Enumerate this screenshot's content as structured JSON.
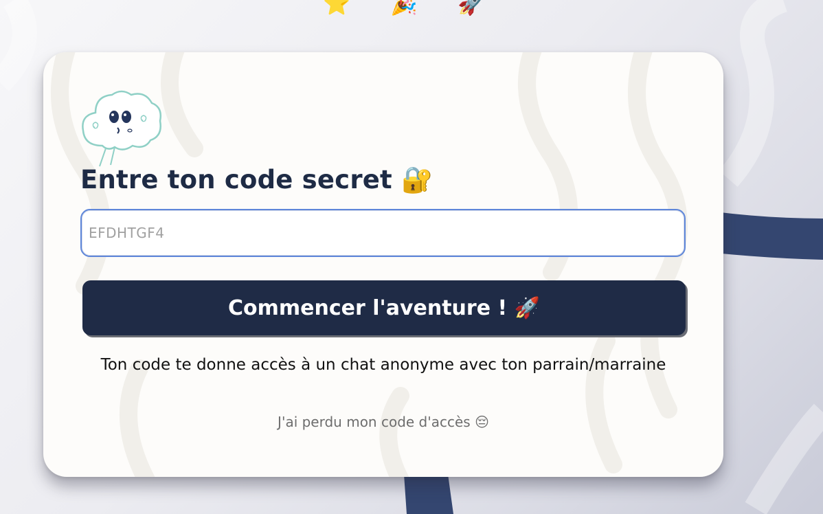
{
  "colors": {
    "accent": "#1f2b46",
    "title_text": "#1e2b45",
    "input_border": "#5e86d9",
    "muted_text": "#6d6d6d",
    "card_background": "#fdfcfa"
  },
  "decorations": {
    "top_emojis": "⭐ 🎉 🚀",
    "mascot_icon": "cloud-mascot-icon"
  },
  "login": {
    "title": "Entre ton code secret 🔐",
    "code_input": {
      "value": "",
      "placeholder": "EFDHTGF4"
    },
    "submit_label": "Commencer l'aventure ! 🚀",
    "info_text": "Ton code te donne accès à un chat anonyme avec ton parrain/marraine",
    "lost_code_link": "J'ai perdu mon code d'accès 😔"
  }
}
